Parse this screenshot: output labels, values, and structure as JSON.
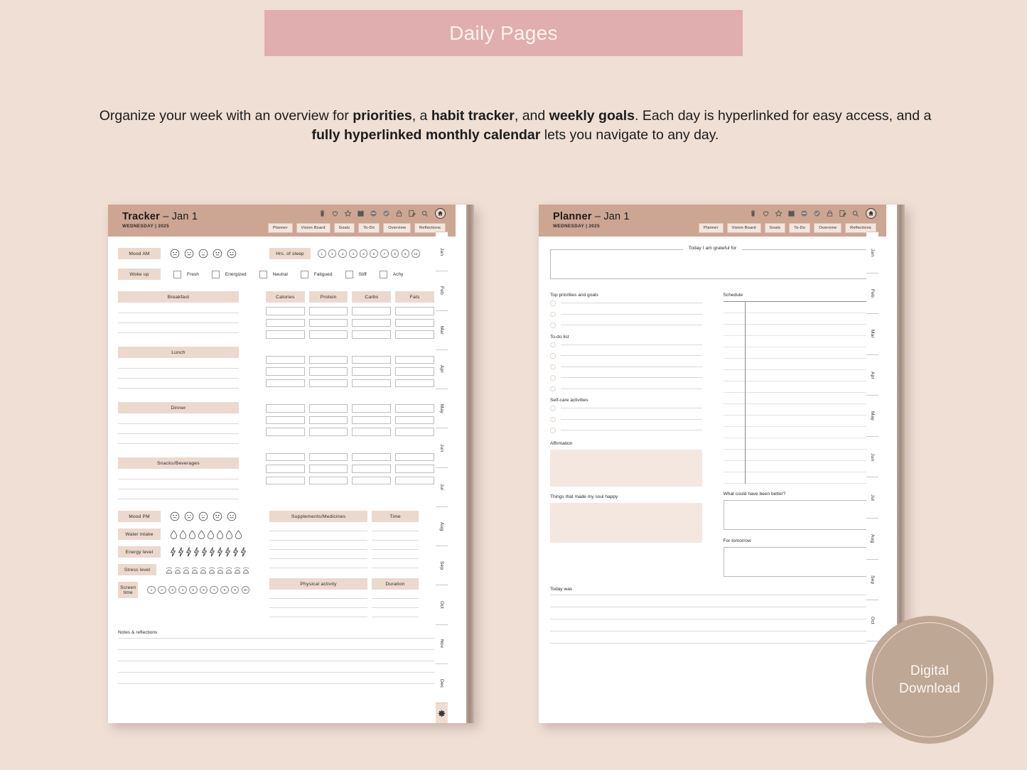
{
  "banner": {
    "title": "Daily Pages"
  },
  "description": {
    "line1_a": "Organize your week with an overview for ",
    "b1": "priorities",
    "line1_b": ", a ",
    "b2": "habit tracker",
    "line1_c": ", and ",
    "b3": "weekly goals",
    "line1_d": ". Each day is hyperlinked for easy access, and a ",
    "b4": "fully hyperlinked monthly calendar",
    "line1_e": " lets you navigate to any day."
  },
  "colors": {
    "background": "#efdfd5",
    "banner": "#e0aeae",
    "header": "#cda593",
    "pill": "#ecd9cd",
    "fill_box": "#f4e7e0",
    "badge": "#bfa795"
  },
  "toolbar_icons": [
    "trash-icon",
    "heart-icon",
    "star-icon",
    "calendar-icon",
    "sticker-icon",
    "circle-icon",
    "lock-icon",
    "note-edit-icon",
    "search-icon",
    "home-icon"
  ],
  "nav_tabs": [
    "Planner",
    "Vision Board",
    "Goals",
    "To-Do",
    "Overview",
    "Reflections"
  ],
  "months": [
    "Jan",
    "Feb",
    "Mar",
    "Apr",
    "May",
    "Jun",
    "Jul",
    "Aug",
    "Sep",
    "Oct",
    "Nov",
    "Dec"
  ],
  "settings_icon": "gear-icon",
  "tracker_page": {
    "title_bold": "Tracker",
    "title_rest": " – Jan 1",
    "subtitle": "WEDNESDAY | 2025",
    "mood_am_label": "Mood AM",
    "sleep_label": "Hrs. of sleep",
    "sleep_values": [
      "1",
      "2",
      "3",
      "4",
      "5",
      "6",
      "7",
      "8",
      "9",
      "10"
    ],
    "woke_up_label": "Woke up",
    "woke_up_options": [
      "Fresh",
      "Energized",
      "Neutral",
      "Fatigued",
      "Stiff",
      "Achy"
    ],
    "meals": [
      "Breakfast",
      "Lunch",
      "Dinner",
      "Snacks/Beverages"
    ],
    "macro_headers": [
      "Calories",
      "Protein",
      "Carbs",
      "Fats"
    ],
    "mood_pm_label": "Mood PM",
    "water_label": "Water intake",
    "water_count": 8,
    "energy_label": "Energy level",
    "energy_count": 10,
    "stress_label": "Stress level",
    "stress_count": 10,
    "screen_label": "Screen time",
    "screen_values": [
      "1",
      "2",
      "3",
      "4",
      "5",
      "6",
      "7",
      "8",
      "9",
      "10"
    ],
    "supplements_header": "Supplements/Medicines",
    "supplements_time_header": "Time",
    "activity_header": "Physical activity",
    "activity_duration_header": "Duration",
    "notes_label": "Notes & reflections"
  },
  "planner_page": {
    "title_bold": "Planner",
    "title_rest": " – Jan 1",
    "subtitle": "WEDNESDAY | 2025",
    "grateful_label": "Today I am grateful for",
    "priorities_label": "Top priorities and goals",
    "priorities_count": 3,
    "todo_label": "To-do list",
    "todo_count": 5,
    "selfcare_label": "Self-care activities",
    "selfcare_count": 3,
    "affirmation_label": "Affirmation",
    "soul_happy_label": "Things that made my soul happy",
    "today_was_label": "Today was",
    "schedule_label": "Schedule",
    "schedule_rows": 16,
    "better_label": "What could have been better?",
    "tomorrow_label": "For tomorrow"
  },
  "badge": {
    "line1": "Digital",
    "line2": "Download"
  }
}
